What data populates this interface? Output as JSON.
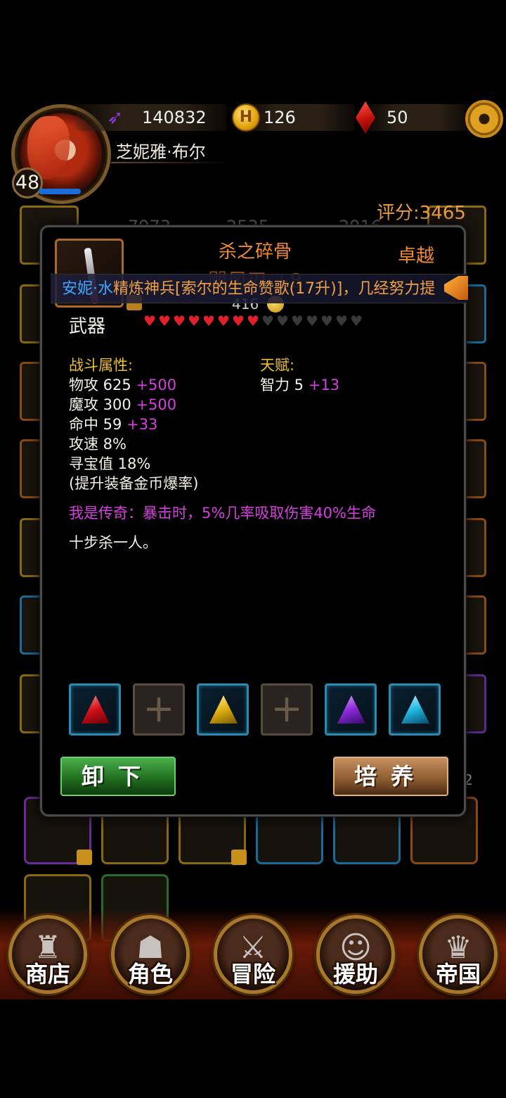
{
  "player": {
    "power": "140832",
    "gold": "126",
    "gems": "50",
    "name": "芝妮雅·布尔",
    "level": "48"
  },
  "score_text": "评分:3465",
  "background_stats": [
    "7973",
    "2535",
    "2916"
  ],
  "background_right_value": "2",
  "item": {
    "name": "杀之碎骨",
    "subtitle": "飓风刃 +8",
    "quality": "卓越",
    "price": "416",
    "slot_type": "武器",
    "stars_filled": 8,
    "stars_total": 15,
    "combat_title": "战斗属性:",
    "combat_stats": [
      {
        "label": "物攻 625",
        "bonus": "+500"
      },
      {
        "label": "魔攻 300",
        "bonus": "+500"
      },
      {
        "label": "命中 59",
        "bonus": "+33"
      },
      {
        "label": "攻速 8%",
        "bonus": ""
      },
      {
        "label": "寻宝值 18%",
        "bonus": ""
      },
      {
        "label": "(提升装备金币爆率)",
        "bonus": ""
      }
    ],
    "talent_title": "天赋:",
    "talent_stats": [
      {
        "label": "智力 5",
        "bonus": "+13"
      }
    ],
    "legend_text": "我是传奇：暴击时，5%几率吸取伤害40%生命",
    "flavor_text": "十步杀一人。",
    "gem_slots": [
      "red",
      "empty",
      "yellow",
      "empty",
      "purple",
      "cyan"
    ],
    "buttons": {
      "unequip": "卸下",
      "train": "培养"
    }
  },
  "marquee": {
    "player": "安妮·水",
    "text": "精炼神兵[索尔的生命赞歌(17升)]，几经努力提"
  },
  "nav": [
    {
      "label": "商店",
      "icon": "castle-icon"
    },
    {
      "label": "角色",
      "icon": "hood-icon"
    },
    {
      "label": "冒险",
      "icon": "dungeon-gate-icon"
    },
    {
      "label": "援助",
      "icon": "ally-portrait-icon"
    },
    {
      "label": "帝国",
      "icon": "crown-icon"
    }
  ],
  "colors": {
    "accent_orange": "#f08a30",
    "bonus_magenta": "#d640e0",
    "section_gold": "#f0c030",
    "marquee_player_blue": "#3aa8ff"
  }
}
